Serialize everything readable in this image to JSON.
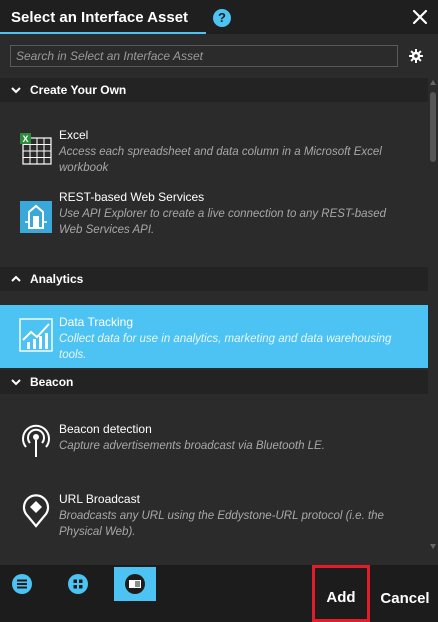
{
  "title": "Select an Interface Asset",
  "help_icon": "?",
  "search": {
    "placeholder": "Search in Select an Interface Asset"
  },
  "colors": {
    "accent": "#4cc3f2",
    "highlight_border": "#e01e2a"
  },
  "sections": [
    {
      "title": "Create Your Own",
      "items": [
        {
          "name": "Excel",
          "description": "Access each spreadsheet and data column in a Microsoft Excel workbook",
          "icon": "excel-icon"
        },
        {
          "name": "REST-based Web Services",
          "description": "Use API Explorer to create a live connection to any REST-based Web Services API.",
          "icon": "web-services-icon"
        }
      ]
    },
    {
      "title": "Analytics",
      "items": [
        {
          "name": "Data Tracking",
          "description": "Collect data for use in analytics, marketing and data warehousing tools.",
          "icon": "data-tracking-icon",
          "selected": true
        }
      ]
    },
    {
      "title": "Beacon",
      "items": [
        {
          "name": "Beacon detection",
          "description": "Capture advertisements broadcast via Bluetooth LE.",
          "icon": "beacon-icon"
        },
        {
          "name": "URL Broadcast",
          "description": "Broadcasts any URL using the Eddystone-URL protocol (i.e. the Physical Web).",
          "icon": "url-broadcast-icon"
        }
      ]
    }
  ],
  "footer": {
    "views": [
      "list-view-icon",
      "grid-view-icon",
      "card-view-icon"
    ],
    "active_view": "card-view-icon",
    "add_label": "Add",
    "cancel_label": "Cancel"
  }
}
